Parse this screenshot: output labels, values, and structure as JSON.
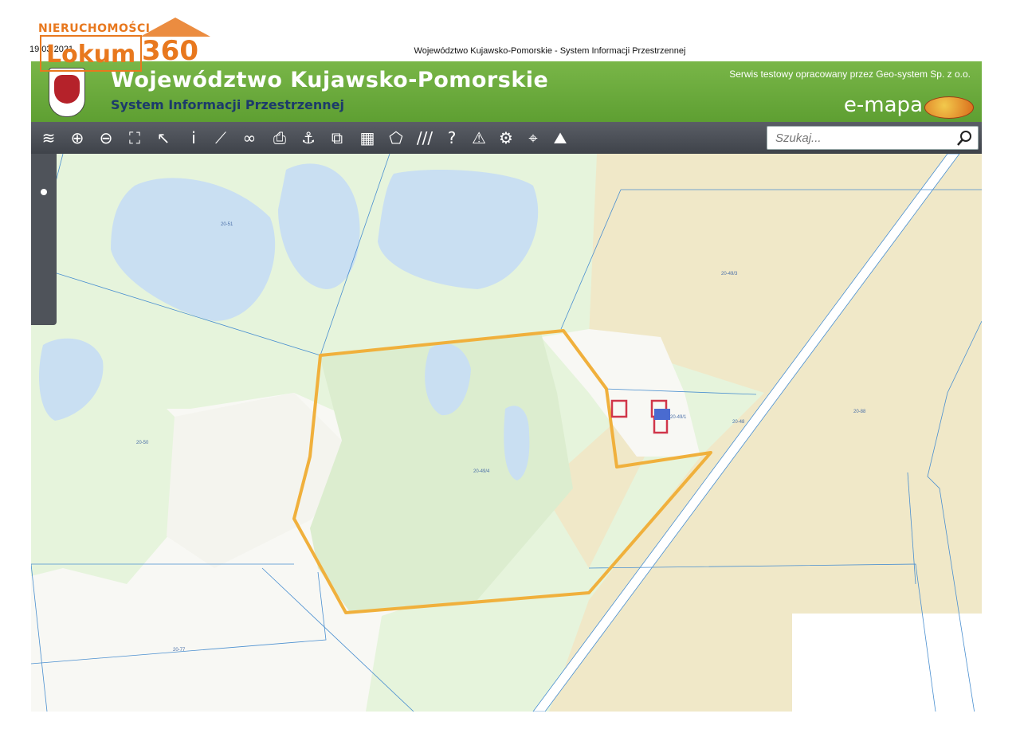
{
  "print": {
    "date": "19.03.2021",
    "title": "Województwo Kujawsko-Pomorskie - System Informacji Przestrzennej"
  },
  "watermark": {
    "line1": "NIERUCHOMOŚCI",
    "brand": "Lokum",
    "number": "360",
    "color": "#e8781e"
  },
  "header": {
    "title": "Województwo Kujawsko-Pomorskie",
    "subtitle": "System Informacji Przestrzennej",
    "test_notice": "Serwis testowy opracowany przez Geo-system Sp. z o.o.",
    "brand": "e-mapa",
    "colors": {
      "green": "#6aa83a",
      "title_blue": "#1c3a6b"
    }
  },
  "toolbar": {
    "tools": [
      {
        "name": "layers-icon",
        "glyph": "≋"
      },
      {
        "name": "zoom-in-icon",
        "glyph": "⊕"
      },
      {
        "name": "zoom-out-icon",
        "glyph": "⊖"
      },
      {
        "name": "zoom-extent-icon",
        "glyph": "⛶"
      },
      {
        "name": "select-pointer-icon",
        "glyph": "↖"
      },
      {
        "name": "info-icon",
        "glyph": "i"
      },
      {
        "name": "measure-icon",
        "glyph": "⟋"
      },
      {
        "name": "link-icon",
        "glyph": "∞"
      },
      {
        "name": "print-icon",
        "glyph": "⎙"
      },
      {
        "name": "anchor-icon",
        "glyph": "⚓"
      },
      {
        "name": "copy-icon",
        "glyph": "⧉"
      },
      {
        "name": "layout-icon",
        "glyph": "▦"
      },
      {
        "name": "shape-icon",
        "glyph": "⬠"
      },
      {
        "name": "hatch-icon",
        "glyph": "///"
      },
      {
        "name": "help-icon",
        "glyph": "?"
      },
      {
        "name": "warning-icon",
        "glyph": "⚠"
      },
      {
        "name": "settings-icon",
        "glyph": "⚙"
      },
      {
        "name": "location-icon",
        "glyph": "⌖"
      },
      {
        "name": "terrain-icon",
        "glyph": "⛰"
      }
    ],
    "search_placeholder": "Szukaj..."
  },
  "map": {
    "parcel_labels": [
      "20-51",
      "20-49/3",
      "20-50",
      "20-49/4",
      "20-49/1",
      "20-48",
      "20-88",
      "20-77"
    ],
    "colors": {
      "meadow": "#e6f4dc",
      "field": "#f0e8c8",
      "water": "#c9dff2",
      "white_area": "#f8f8f4",
      "parcel_line": "#4a8fd0",
      "highlight": "#f0b03c",
      "building": "#d0364a"
    }
  }
}
